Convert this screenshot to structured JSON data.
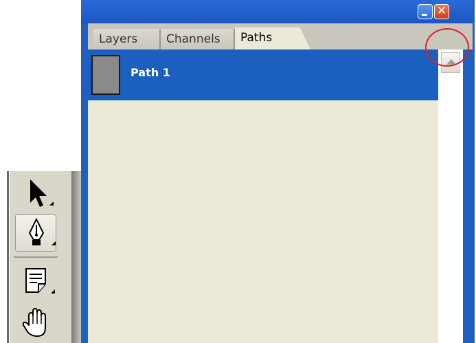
{
  "panel": {
    "tabs": [
      {
        "label": "Layers",
        "active": false
      },
      {
        "label": "Channels",
        "active": false
      },
      {
        "label": "Paths",
        "active": true
      }
    ],
    "paths": [
      {
        "name": "Path 1",
        "selected": true
      }
    ],
    "window_buttons": {
      "close_glyph": "✕"
    }
  },
  "toolbox": {
    "tools": [
      {
        "icon": "path-selection-arrow-icon"
      },
      {
        "icon": "pen-tool-icon",
        "active": true
      },
      {
        "icon": "notes-icon"
      },
      {
        "icon": "hand-tool-icon"
      }
    ]
  },
  "annotations": [
    {
      "target": "palette-menu-button",
      "color": "#e21f26"
    },
    {
      "target": "pen-tool",
      "color": "#e21f26"
    }
  ],
  "colors": {
    "titlebar": "#1f5fbf",
    "selection": "#1b5fbf",
    "panel_bg": "#ece9d8",
    "annotation": "#e21f26"
  }
}
